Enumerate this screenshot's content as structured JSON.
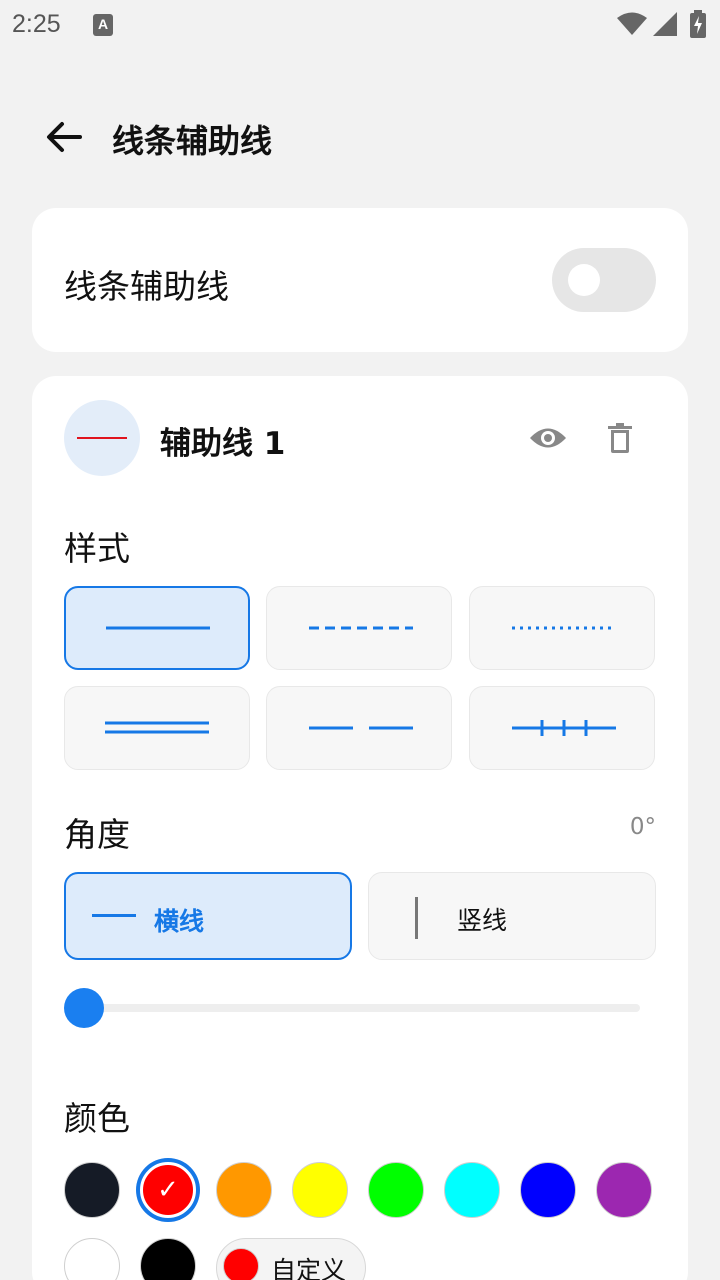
{
  "status_bar": {
    "time": "2:25",
    "notification_letter": "A"
  },
  "app_bar": {
    "title": "线条辅助线"
  },
  "master_toggle": {
    "label": "线条辅助线",
    "on": false
  },
  "guide": {
    "name": "辅助线 1",
    "line_color": "#e0141e",
    "style_label": "样式",
    "styles": [
      {
        "name": "solid",
        "selected": true
      },
      {
        "name": "dashed",
        "selected": false
      },
      {
        "name": "dotted",
        "selected": false
      },
      {
        "name": "double",
        "selected": false
      },
      {
        "name": "long-dash",
        "selected": false
      },
      {
        "name": "tick-marks",
        "selected": false
      }
    ],
    "angle_label": "角度",
    "angle_value": "0°",
    "orientation": [
      {
        "label": "横线",
        "selected": true
      },
      {
        "label": "竖线",
        "selected": false
      }
    ],
    "angle_slider_fraction": 0.0,
    "color_label": "颜色",
    "colors": [
      {
        "hex": "#151b26",
        "selected": false
      },
      {
        "hex": "#ff0000",
        "selected": true
      },
      {
        "hex": "#ff9800",
        "selected": false
      },
      {
        "hex": "#ffff00",
        "selected": false
      },
      {
        "hex": "#00ff00",
        "selected": false
      },
      {
        "hex": "#00ffff",
        "selected": false
      },
      {
        "hex": "#0000ff",
        "selected": false
      },
      {
        "hex": "#9c27b0",
        "selected": false
      },
      {
        "hex": "#ffffff",
        "selected": false
      },
      {
        "hex": "#000000",
        "selected": false
      }
    ],
    "custom_label": "自定义",
    "custom_color": "#ff0000",
    "selected_check": "✓"
  },
  "accent_color": "#1678e6"
}
